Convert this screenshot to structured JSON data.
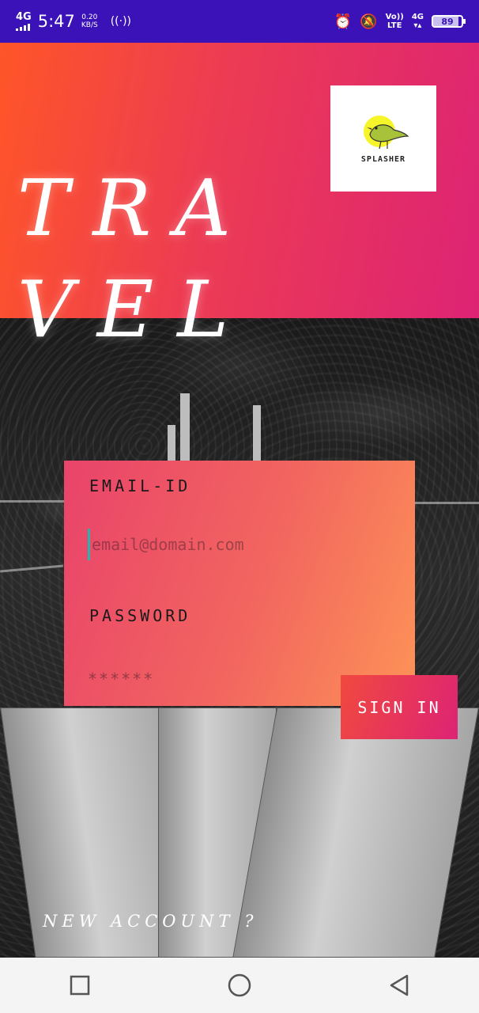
{
  "status_bar": {
    "network": "4G",
    "time": "5:47",
    "speed_value": "0.20",
    "speed_unit": "KB/S",
    "volte": "Vo))",
    "lte": "LTE",
    "net_type": "4G",
    "battery": "89",
    "icons": [
      "hotspot-icon",
      "alarm-icon",
      "mute-icon"
    ]
  },
  "header": {
    "title_line1": "TRA",
    "title_line2": "VEL",
    "logo_text": "SPLASHER",
    "colors": {
      "start": "#ff5528",
      "end": "#dd2374"
    }
  },
  "login": {
    "email_label": "EMAIL-ID",
    "email_placeholder": "email@domain.com",
    "password_label": "PASSWORD",
    "password_placeholder": "******",
    "signin_label": "SIGN IN",
    "new_account_label": "NEW ACCOUNT ?"
  },
  "navbar": {
    "buttons": [
      "recent-apps",
      "home",
      "back"
    ]
  }
}
